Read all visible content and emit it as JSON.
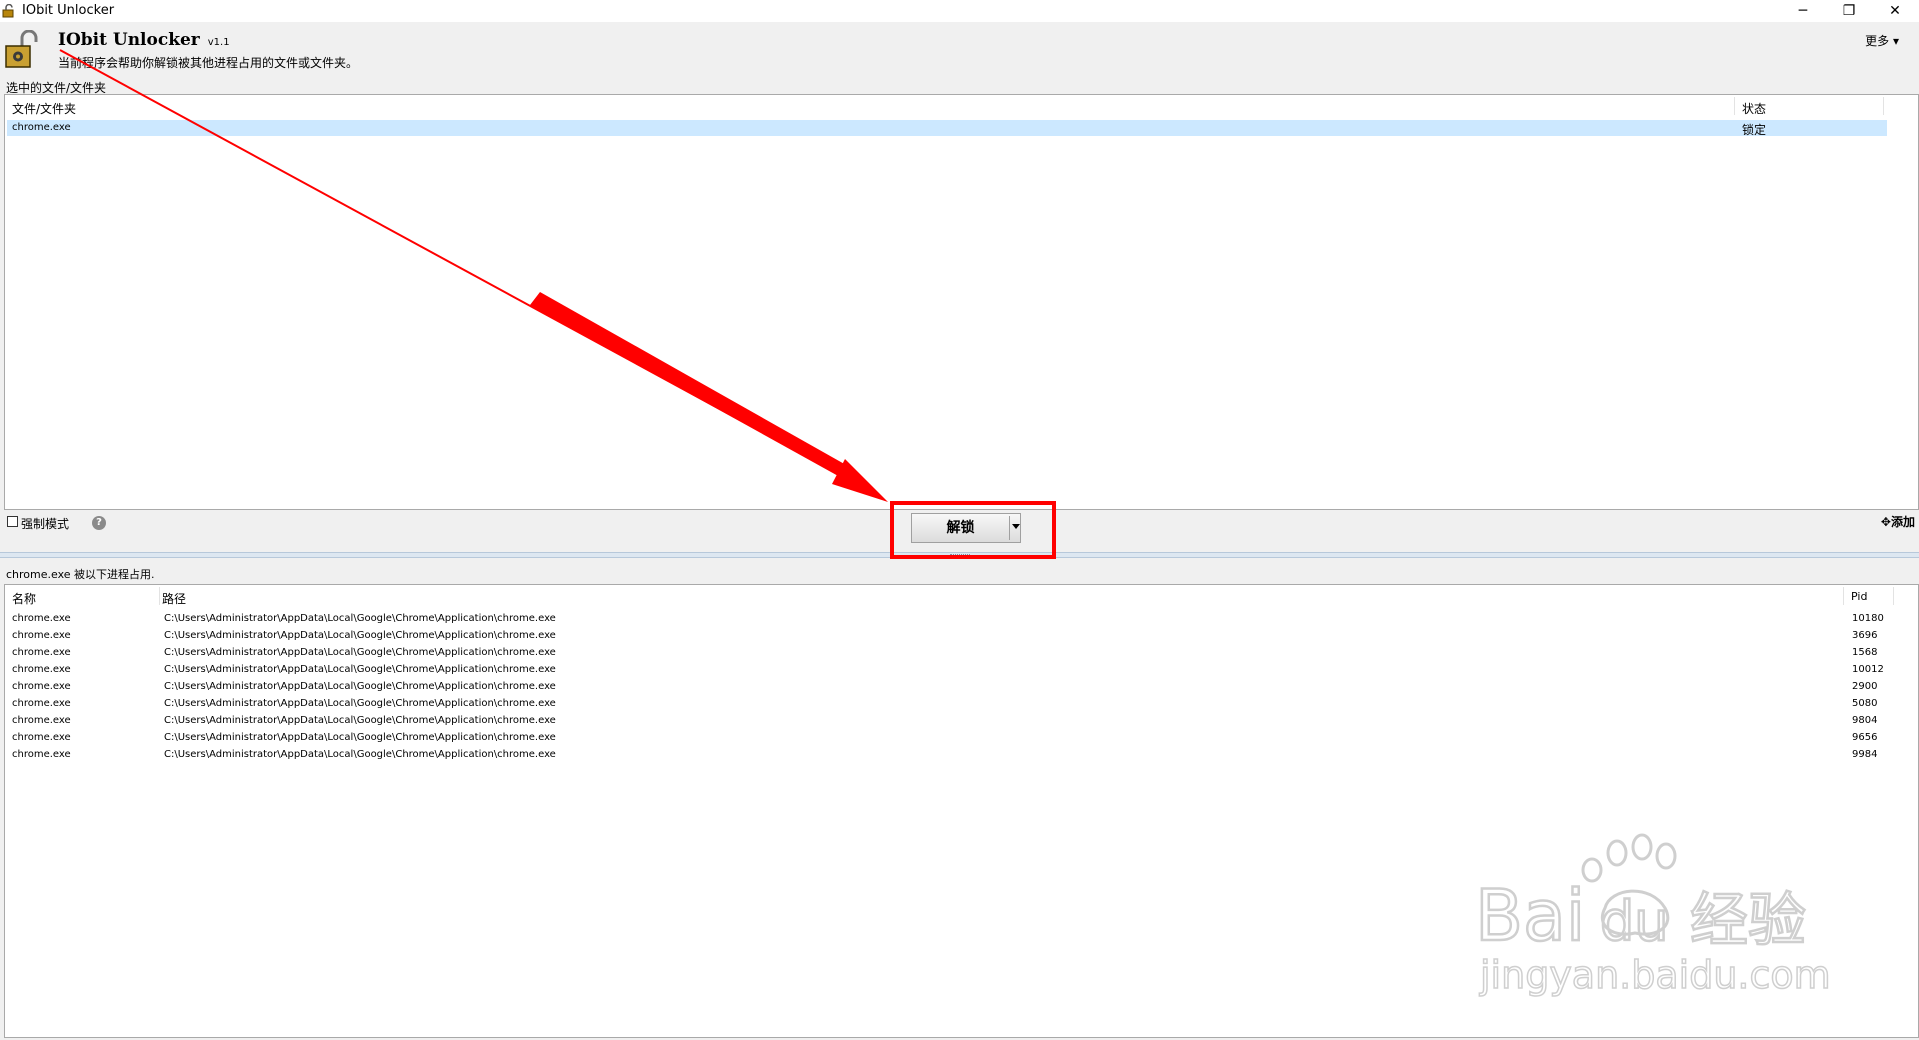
{
  "window": {
    "title": "IObit Unlocker",
    "minimize_glyph": "─",
    "restore_glyph": "❐",
    "close_glyph": "✕"
  },
  "header": {
    "app_name": "IObit Unlocker",
    "version": "v1.1",
    "description": "当前程序会帮助你解锁被其他进程占用的文件或文件夹。",
    "more_menu": "更多 ▾",
    "logo_icon": "lock-icon"
  },
  "selected_section": {
    "label": "选中的文件/文件夹",
    "columns": [
      "文件/文件夹",
      "状态"
    ],
    "rows": [
      {
        "name": "chrome.exe",
        "status": "锁定",
        "selected": true
      }
    ]
  },
  "toolbar": {
    "force_mode_label": "强制模式",
    "force_mode_checked": false,
    "help_glyph": "?",
    "unlock_label": "解锁",
    "add_label": "添加",
    "add_glyph": "✥"
  },
  "process_section": {
    "label": "chrome.exe 被以下进程占用.",
    "columns": [
      "名称",
      "路径",
      "Pid"
    ],
    "rows": [
      {
        "name": "chrome.exe",
        "path": "C:\\Users\\Administrator\\AppData\\Local\\Google\\Chrome\\Application\\chrome.exe",
        "pid": "10180"
      },
      {
        "name": "chrome.exe",
        "path": "C:\\Users\\Administrator\\AppData\\Local\\Google\\Chrome\\Application\\chrome.exe",
        "pid": "3696"
      },
      {
        "name": "chrome.exe",
        "path": "C:\\Users\\Administrator\\AppData\\Local\\Google\\Chrome\\Application\\chrome.exe",
        "pid": "1568"
      },
      {
        "name": "chrome.exe",
        "path": "C:\\Users\\Administrator\\AppData\\Local\\Google\\Chrome\\Application\\chrome.exe",
        "pid": "10012"
      },
      {
        "name": "chrome.exe",
        "path": "C:\\Users\\Administrator\\AppData\\Local\\Google\\Chrome\\Application\\chrome.exe",
        "pid": "2900"
      },
      {
        "name": "chrome.exe",
        "path": "C:\\Users\\Administrator\\AppData\\Local\\Google\\Chrome\\Application\\chrome.exe",
        "pid": "5080"
      },
      {
        "name": "chrome.exe",
        "path": "C:\\Users\\Administrator\\AppData\\Local\\Google\\Chrome\\Application\\chrome.exe",
        "pid": "9804"
      },
      {
        "name": "chrome.exe",
        "path": "C:\\Users\\Administrator\\AppData\\Local\\Google\\Chrome\\Application\\chrome.exe",
        "pid": "9656"
      },
      {
        "name": "chrome.exe",
        "path": "C:\\Users\\Administrator\\AppData\\Local\\Google\\Chrome\\Application\\chrome.exe",
        "pid": "9984"
      }
    ]
  },
  "watermark": {
    "brand": "Bai",
    "brand_du": "du",
    "brand_cn": "经验",
    "url": "jingyan.baidu.com"
  },
  "colors": {
    "selection": "#cce8ff",
    "annotation_red": "#ff0000",
    "watermark": "#cfcfcf"
  }
}
